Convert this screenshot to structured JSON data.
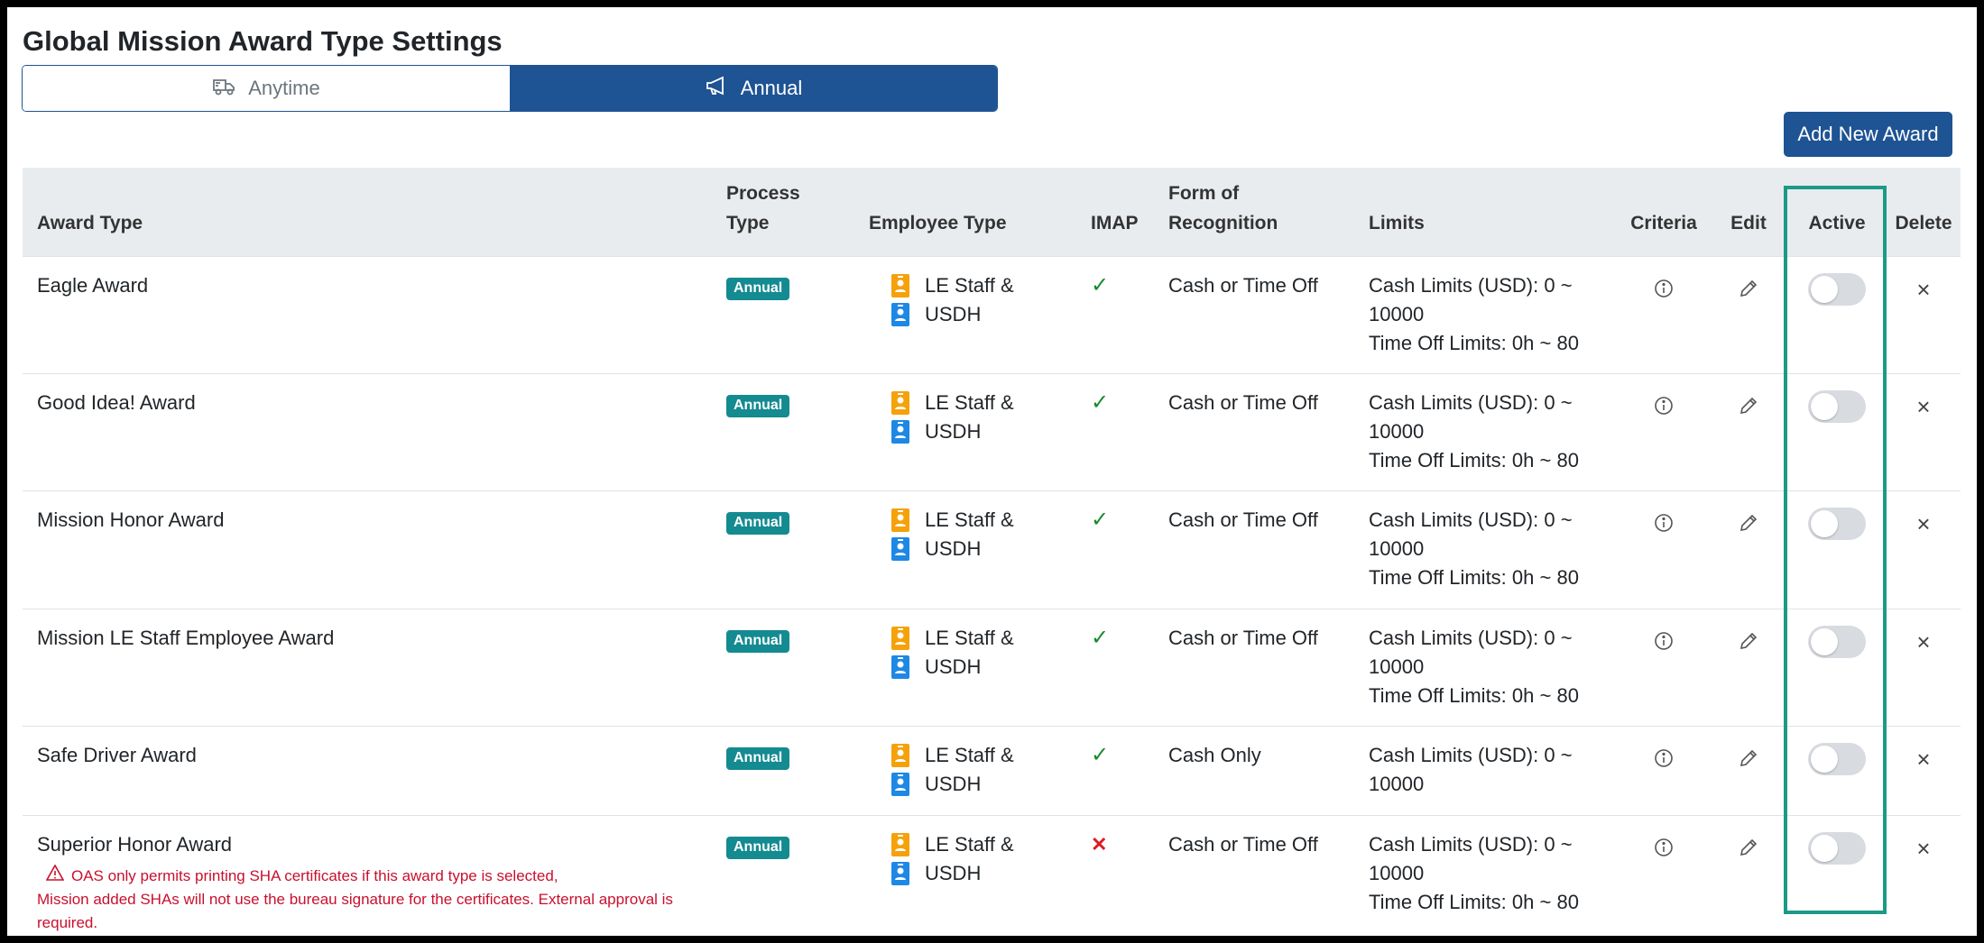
{
  "page_title": "Global Mission Award Type Settings",
  "tabs": [
    {
      "label": "Anytime",
      "icon": "truck-icon",
      "active": false
    },
    {
      "label": "Annual",
      "icon": "megaphone-icon",
      "active": true
    }
  ],
  "add_button": "Add New Award",
  "columns": {
    "award_type": "Award Type",
    "process_type_1": "Process",
    "process_type_2": "Type",
    "employee_type": "Employee Type",
    "imap": "IMAP",
    "form_1": "Form of",
    "form_2": "Recognition",
    "limits": "Limits",
    "criteria": "Criteria",
    "edit": "Edit",
    "active": "Active",
    "delete": "Delete"
  },
  "rows": [
    {
      "award": "Eagle Award",
      "process": "Annual",
      "emp1": "LE Staff &",
      "emp2": "USDH",
      "imap": "✓",
      "form": "Cash or Time Off",
      "cash1": "Cash Limits (USD): 0 ~",
      "cash2": "10000",
      "time": "Time Off Limits: 0h ~ 80",
      "active": false
    },
    {
      "award": "Good Idea! Award",
      "process": "Annual",
      "emp1": "LE Staff &",
      "emp2": "USDH",
      "imap": "✓",
      "form": "Cash or Time Off",
      "cash1": "Cash Limits (USD): 0 ~",
      "cash2": "10000",
      "time": "Time Off Limits: 0h ~ 80",
      "active": false
    },
    {
      "award": "Mission Honor Award",
      "process": "Annual",
      "emp1": "LE Staff &",
      "emp2": "USDH",
      "imap": "✓",
      "form": "Cash or Time Off",
      "cash1": "Cash Limits (USD): 0 ~",
      "cash2": "10000",
      "time": "Time Off Limits: 0h ~ 80",
      "active": false
    },
    {
      "award": "Mission LE Staff Employee Award",
      "process": "Annual",
      "emp1": "LE Staff &",
      "emp2": "USDH",
      "imap": "✓",
      "form": "Cash or Time Off",
      "cash1": "Cash Limits (USD): 0 ~",
      "cash2": "10000",
      "time": "Time Off Limits: 0h ~ 80",
      "active": false
    },
    {
      "award": "Safe Driver Award",
      "process": "Annual",
      "emp1": "LE Staff &",
      "emp2": "USDH",
      "imap": "✓",
      "form": "Cash Only",
      "cash1": "Cash Limits (USD): 0 ~",
      "cash2": "10000",
      "time": "",
      "active": false
    },
    {
      "award": "Superior Honor Award",
      "process": "Annual",
      "emp1": "LE Staff &",
      "emp2": "USDH",
      "imap": "✕",
      "form": "Cash or Time Off",
      "cash1": "Cash Limits (USD): 0 ~",
      "cash2": "10000",
      "time": "Time Off Limits: 0h ~ 80",
      "active": false,
      "warning_1": "OAS only permits printing SHA certificates if this award type is selected,",
      "warning_2": "Mission added SHAs will not use the bureau signature for the certificates. External approval is required."
    }
  ],
  "colors": {
    "primary": "#1e5394",
    "badge": "#148a91",
    "check": "#1a8a2e",
    "cross": "#dc1c23",
    "warning": "#c8102e",
    "highlight": "#1c9a86"
  }
}
